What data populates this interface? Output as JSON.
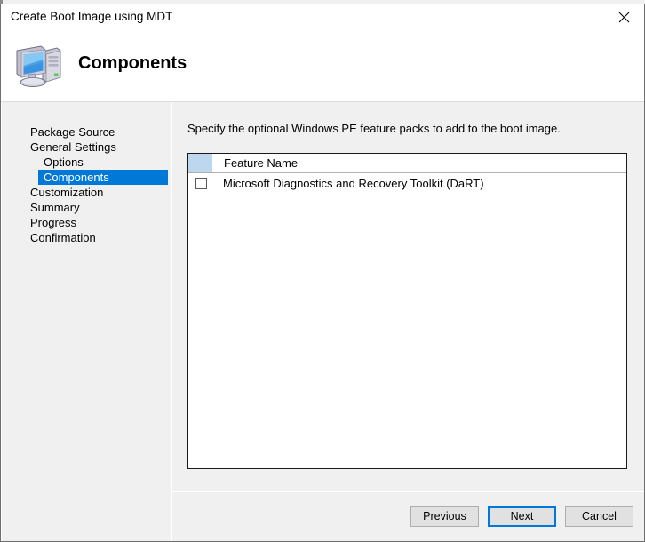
{
  "window": {
    "title": "Create Boot Image using MDT",
    "close_label": "Close",
    "close_icon": "close-icon"
  },
  "banner": {
    "title": "Components",
    "icon": "computer-icon"
  },
  "sidebar": {
    "items": [
      {
        "label": "Package Source",
        "level": 0,
        "selected": false
      },
      {
        "label": "General Settings",
        "level": 0,
        "selected": false
      },
      {
        "label": "Options",
        "level": 1,
        "selected": false
      },
      {
        "label": "Components",
        "level": 1,
        "selected": true
      },
      {
        "label": "Customization",
        "level": 0,
        "selected": false
      },
      {
        "label": "Summary",
        "level": 0,
        "selected": false
      },
      {
        "label": "Progress",
        "level": 0,
        "selected": false
      },
      {
        "label": "Confirmation",
        "level": 0,
        "selected": false
      }
    ],
    "selected_color": "#0078d7"
  },
  "main": {
    "instruction": "Specify the optional Windows PE feature packs to add to the boot image.",
    "table": {
      "columns": [
        {
          "name": "select-column",
          "label": ""
        },
        {
          "name": "feature-name-column",
          "label": "Feature Name"
        }
      ],
      "header_accent_color": "#bdd7ee",
      "rows": [
        {
          "checked": false,
          "feature_name": "Microsoft Diagnostics and Recovery Toolkit (DaRT)"
        }
      ]
    }
  },
  "footer": {
    "previous_label": "Previous",
    "next_label": "Next",
    "cancel_label": "Cancel",
    "default_button": "Next"
  }
}
